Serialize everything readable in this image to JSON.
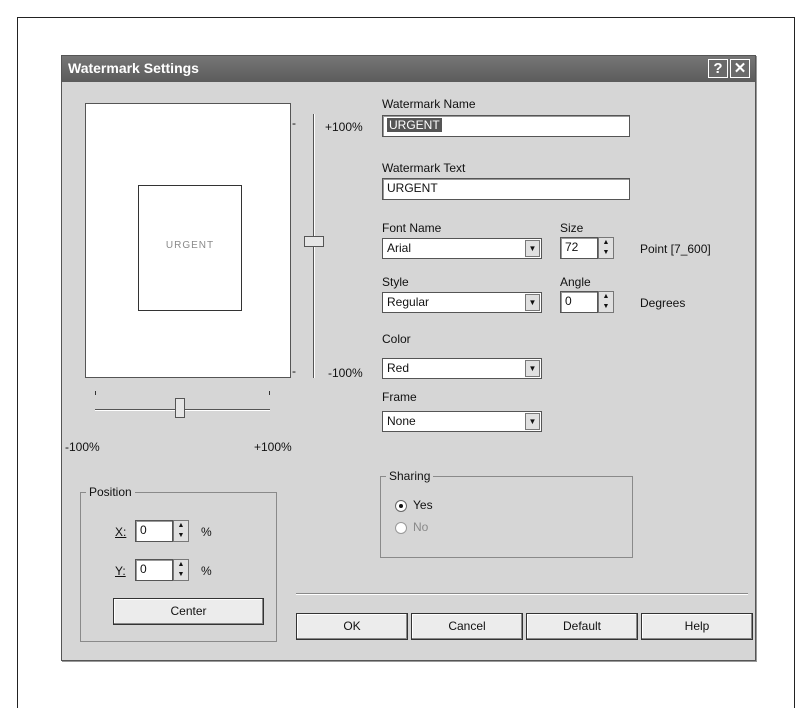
{
  "window": {
    "title": "Watermark Settings",
    "help_glyph": "?",
    "close_glyph": "✕"
  },
  "preview": {
    "sample_text": "URGENT"
  },
  "h_slider": {
    "min_label": "-100%",
    "max_label": "+100%"
  },
  "v_slider": {
    "top_label": "+100%",
    "bottom_label": "-100%",
    "tick": "-"
  },
  "fields": {
    "watermark_name": {
      "label": "Watermark Name",
      "value": "URGENT"
    },
    "watermark_text": {
      "label": "Watermark Text",
      "value": "URGENT"
    },
    "font_name": {
      "label": "Font Name",
      "value": "Arial"
    },
    "size": {
      "label": "Size",
      "value": "72",
      "unit": "Point [7_600]"
    },
    "style": {
      "label": "Style",
      "value": "Regular"
    },
    "angle": {
      "label": "Angle",
      "value": "0",
      "unit": "Degrees"
    },
    "color": {
      "label": "Color",
      "value": "Red"
    },
    "frame": {
      "label": "Frame",
      "value": "None"
    }
  },
  "position": {
    "title": "Position",
    "x_label": "X:",
    "x_value": "0",
    "x_unit": "%",
    "y_label": "Y:",
    "y_value": "0",
    "y_unit": "%",
    "center_label": "Center"
  },
  "sharing": {
    "title": "Sharing",
    "yes_label": "Yes",
    "no_label": "No"
  },
  "buttons": {
    "ok": "OK",
    "cancel": "Cancel",
    "default": "Default",
    "help": "Help"
  }
}
